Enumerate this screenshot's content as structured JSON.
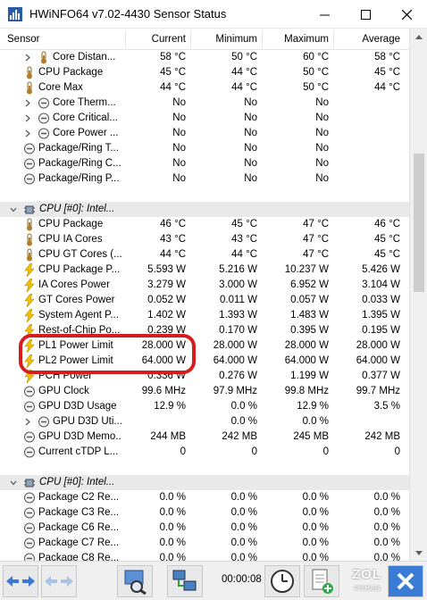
{
  "window": {
    "title": "HWiNFO64 v7.02-4430 Sensor Status",
    "minimize_glyph": "—",
    "maximize_glyph": "☐",
    "close_glyph": "✕"
  },
  "columns": {
    "sensor": "Sensor",
    "current": "Current",
    "minimum": "Minimum",
    "maximum": "Maximum",
    "average": "Average"
  },
  "rows": [
    {
      "kind": "sensor",
      "indent": 2,
      "icon": "thermometer-icon",
      "expander": "chevron-right-icon",
      "name": "Core Distan...",
      "current": "58 °C",
      "minimum": "50 °C",
      "maximum": "60 °C",
      "average": "58 °C"
    },
    {
      "kind": "sensor",
      "indent": 1,
      "icon": "thermometer-icon",
      "name": "CPU Package",
      "current": "45 °C",
      "minimum": "44 °C",
      "maximum": "50 °C",
      "average": "45 °C"
    },
    {
      "kind": "sensor",
      "indent": 1,
      "icon": "thermometer-icon",
      "name": "Core Max",
      "current": "44 °C",
      "minimum": "44 °C",
      "maximum": "50 °C",
      "average": "44 °C"
    },
    {
      "kind": "sensor",
      "indent": 2,
      "icon": "status-circle-icon",
      "expander": "chevron-right-icon",
      "name": "Core Therm...",
      "current": "No",
      "minimum": "No",
      "maximum": "No",
      "average": ""
    },
    {
      "kind": "sensor",
      "indent": 2,
      "icon": "status-circle-icon",
      "expander": "chevron-right-icon",
      "name": "Core Critical...",
      "current": "No",
      "minimum": "No",
      "maximum": "No",
      "average": ""
    },
    {
      "kind": "sensor",
      "indent": 2,
      "icon": "status-circle-icon",
      "expander": "chevron-right-icon",
      "name": "Core Power ...",
      "current": "No",
      "minimum": "No",
      "maximum": "No",
      "average": ""
    },
    {
      "kind": "sensor",
      "indent": 1,
      "icon": "status-circle-icon",
      "name": "Package/Ring T...",
      "current": "No",
      "minimum": "No",
      "maximum": "No",
      "average": ""
    },
    {
      "kind": "sensor",
      "indent": 1,
      "icon": "status-circle-icon",
      "name": "Package/Ring C...",
      "current": "No",
      "minimum": "No",
      "maximum": "No",
      "average": ""
    },
    {
      "kind": "sensor",
      "indent": 1,
      "icon": "status-circle-icon",
      "name": "Package/Ring P...",
      "current": "No",
      "minimum": "No",
      "maximum": "No",
      "average": ""
    },
    {
      "kind": "blank"
    },
    {
      "kind": "group",
      "icon": "cpu-chip-icon",
      "expander": "chevron-down-icon",
      "name": "CPU [#0]: Intel..."
    },
    {
      "kind": "sensor",
      "indent": 1,
      "icon": "thermometer-icon",
      "name": "CPU Package",
      "current": "46 °C",
      "minimum": "45 °C",
      "maximum": "47 °C",
      "average": "46 °C"
    },
    {
      "kind": "sensor",
      "indent": 1,
      "icon": "thermometer-icon",
      "name": "CPU IA Cores",
      "current": "43 °C",
      "minimum": "43 °C",
      "maximum": "47 °C",
      "average": "45 °C"
    },
    {
      "kind": "sensor",
      "indent": 1,
      "icon": "thermometer-icon",
      "name": "CPU GT Cores (...",
      "current": "44 °C",
      "minimum": "44 °C",
      "maximum": "47 °C",
      "average": "45 °C"
    },
    {
      "kind": "sensor",
      "indent": 1,
      "icon": "lightning-icon",
      "name": "CPU Package P...",
      "current": "5.593 W",
      "minimum": "5.216 W",
      "maximum": "10.237 W",
      "average": "5.426 W"
    },
    {
      "kind": "sensor",
      "indent": 1,
      "icon": "lightning-icon",
      "name": "IA Cores Power",
      "current": "3.279 W",
      "minimum": "3.000 W",
      "maximum": "6.952 W",
      "average": "3.104 W"
    },
    {
      "kind": "sensor",
      "indent": 1,
      "icon": "lightning-icon",
      "name": "GT Cores Power",
      "current": "0.052 W",
      "minimum": "0.011 W",
      "maximum": "0.057 W",
      "average": "0.033 W"
    },
    {
      "kind": "sensor",
      "indent": 1,
      "icon": "lightning-icon",
      "name": "System Agent P...",
      "current": "1.402 W",
      "minimum": "1.393 W",
      "maximum": "1.483 W",
      "average": "1.395 W"
    },
    {
      "kind": "sensor",
      "indent": 1,
      "icon": "lightning-icon",
      "name": "Rest-of-Chip Po...",
      "current": "0.239 W",
      "minimum": "0.170 W",
      "maximum": "0.395 W",
      "average": "0.195 W"
    },
    {
      "kind": "sensor",
      "indent": 1,
      "icon": "lightning-icon",
      "name": "PL1 Power Limit",
      "current": "28.000 W",
      "minimum": "28.000 W",
      "maximum": "28.000 W",
      "average": "28.000 W"
    },
    {
      "kind": "sensor",
      "indent": 1,
      "icon": "lightning-icon",
      "name": "PL2 Power Limit",
      "current": "64.000 W",
      "minimum": "64.000 W",
      "maximum": "64.000 W",
      "average": "64.000 W"
    },
    {
      "kind": "sensor",
      "indent": 1,
      "icon": "lightning-icon",
      "name": "PCH Power",
      "current": "0.336 W",
      "minimum": "0.276 W",
      "maximum": "1.199 W",
      "average": "0.377 W"
    },
    {
      "kind": "sensor",
      "indent": 1,
      "icon": "status-circle-icon",
      "name": "GPU Clock",
      "current": "99.6 MHz",
      "minimum": "97.9 MHz",
      "maximum": "99.8 MHz",
      "average": "99.7 MHz"
    },
    {
      "kind": "sensor",
      "indent": 1,
      "icon": "status-circle-icon",
      "name": "GPU D3D Usage",
      "current": "12.9 %",
      "minimum": "0.0 %",
      "maximum": "12.9 %",
      "average": "3.5 %"
    },
    {
      "kind": "sensor",
      "indent": 2,
      "icon": "status-circle-icon",
      "expander": "chevron-right-icon",
      "name": "GPU D3D Uti...",
      "current": "",
      "minimum": "0.0 %",
      "maximum": "0.0 %",
      "average": ""
    },
    {
      "kind": "sensor",
      "indent": 1,
      "icon": "status-circle-icon",
      "name": "GPU D3D Memo...",
      "current": "244 MB",
      "minimum": "242 MB",
      "maximum": "245 MB",
      "average": "242 MB"
    },
    {
      "kind": "sensor",
      "indent": 1,
      "icon": "status-circle-icon",
      "name": "Current cTDP L...",
      "current": "0",
      "minimum": "0",
      "maximum": "0",
      "average": "0"
    },
    {
      "kind": "blank"
    },
    {
      "kind": "group",
      "icon": "cpu-chip-icon",
      "expander": "chevron-down-icon",
      "name": "CPU [#0]: Intel..."
    },
    {
      "kind": "sensor",
      "indent": 1,
      "icon": "status-circle-icon",
      "name": "Package C2 Re...",
      "current": "0.0 %",
      "minimum": "0.0 %",
      "maximum": "0.0 %",
      "average": "0.0 %"
    },
    {
      "kind": "sensor",
      "indent": 1,
      "icon": "status-circle-icon",
      "name": "Package C3 Re...",
      "current": "0.0 %",
      "minimum": "0.0 %",
      "maximum": "0.0 %",
      "average": "0.0 %"
    },
    {
      "kind": "sensor",
      "indent": 1,
      "icon": "status-circle-icon",
      "name": "Package C6 Re...",
      "current": "0.0 %",
      "minimum": "0.0 %",
      "maximum": "0.0 %",
      "average": "0.0 %"
    },
    {
      "kind": "sensor",
      "indent": 1,
      "icon": "status-circle-icon",
      "name": "Package C7 Re...",
      "current": "0.0 %",
      "minimum": "0.0 %",
      "maximum": "0.0 %",
      "average": "0.0 %"
    },
    {
      "kind": "sensor",
      "indent": 1,
      "icon": "status-circle-icon",
      "name": "Package C8 Re...",
      "current": "0.0 %",
      "minimum": "0.0 %",
      "maximum": "0.0 %",
      "average": "0.0 %"
    }
  ],
  "toolbar": {
    "elapsed_time": "00:00:08",
    "buttons": [
      "nav-arrows-icon",
      "nav-arrows-disabled-icon",
      "monitor-magnifier-icon",
      "network-computers-icon",
      "clock-icon",
      "add-document-icon",
      "close-x-icon"
    ]
  },
  "watermark": {
    "text": "ZOL",
    "subtext": "中关村在线"
  },
  "colors": {
    "highlight": "#d61c1c",
    "group_row_bg": "#e9e9e9",
    "lightning": "#f2c200",
    "thermometer": "#b07d28"
  }
}
